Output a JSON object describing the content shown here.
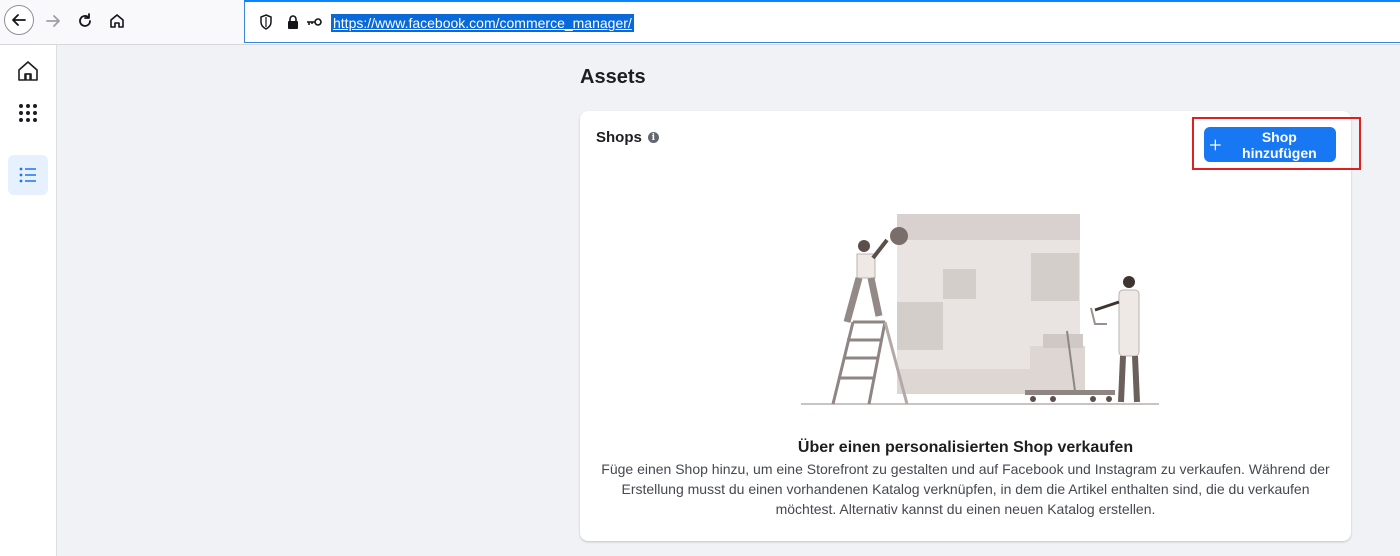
{
  "browser": {
    "url": "https://www.facebook.com/commerce_manager/"
  },
  "rail": {
    "items": [
      "home-icon",
      "apps-grid-icon",
      "list-icon"
    ]
  },
  "main": {
    "page_title": "Assets",
    "card": {
      "title": "Shops",
      "add_button_label": "Shop hinzufügen",
      "empty_title": "Über einen personalisierten Shop verkaufen",
      "empty_description": "Füge einen Shop hinzu, um eine Storefront zu gestalten und auf Facebook und Instagram zu verkaufen. Während der Erstellung musst du einen vorhandenen Katalog verknüpfen, in dem die Artikel enthalten sind, die du verkaufen möchtest. Alternativ kannst du einen neuen Katalog erstellen."
    }
  },
  "colors": {
    "accent": "#1877f2",
    "highlight": "#e02020"
  }
}
